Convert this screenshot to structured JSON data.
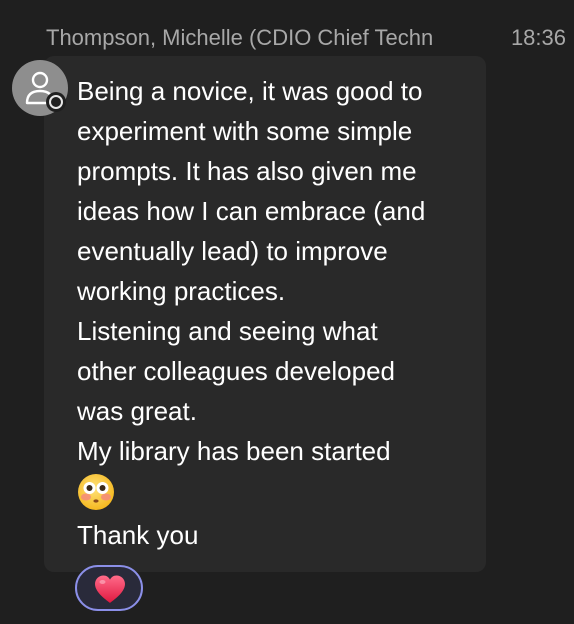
{
  "header": {
    "sender": "Thompson, Michelle (CDIO Chief Techn",
    "time": "18:36"
  },
  "avatar": {
    "icon": "person-icon",
    "presence_icon": "presence-status-icon"
  },
  "message": {
    "lines": [
      "Being a novice, it was good to",
      "experiment with some simple",
      "prompts.  It has also given me",
      "ideas how I can embrace (and",
      "eventually lead) to improve",
      "working practices.",
      "Listening and seeing what",
      "other colleagues developed",
      "was great.",
      "My library has been started"
    ],
    "emoji": "flushed-face-emoji",
    "closing": "Thank you"
  },
  "reaction": {
    "emoji": "heart-emoji",
    "colors": {
      "border": "#8b8fe8",
      "heart": "#f0305a"
    }
  }
}
